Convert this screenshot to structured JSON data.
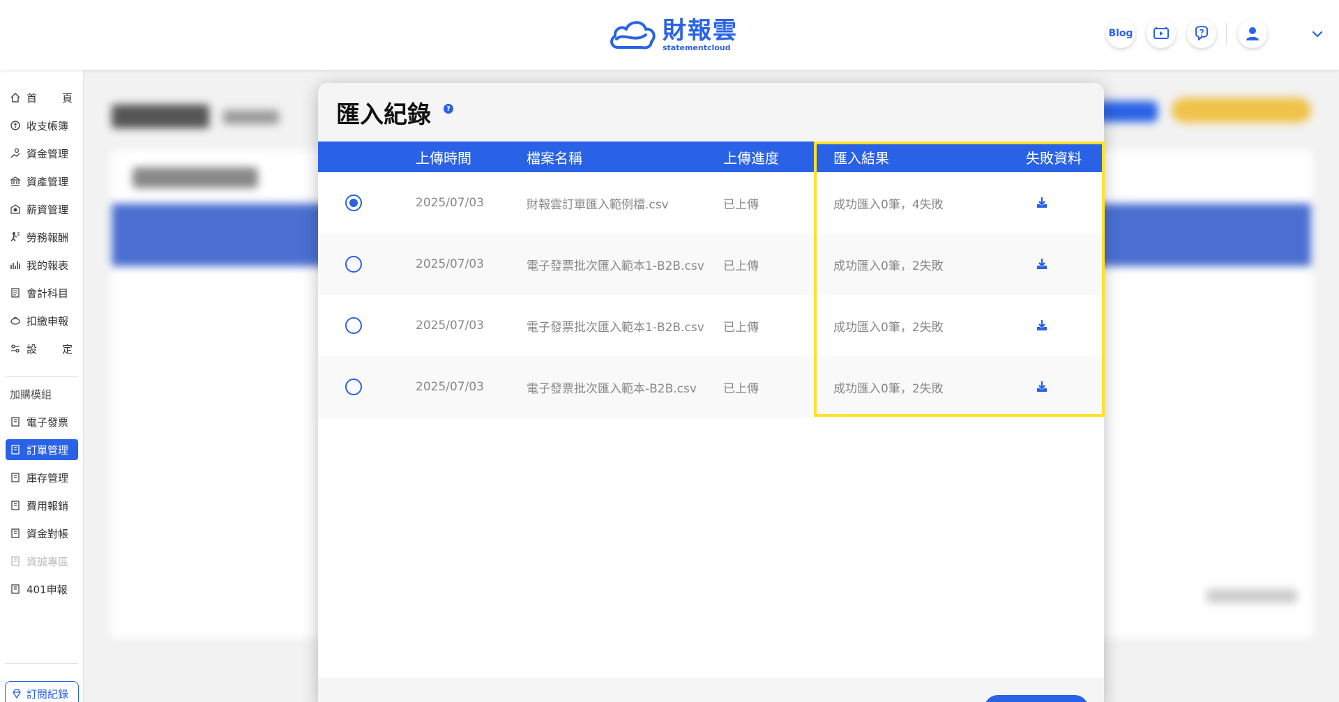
{
  "header": {
    "logo_cn": "財報雲",
    "logo_en": "statementcloud",
    "blog_label": "Blog"
  },
  "sidebar": {
    "items": [
      {
        "name": "home",
        "label": "首 頁",
        "icon": "home-icon"
      },
      {
        "name": "ledger",
        "label": "收支帳簿",
        "icon": "coin-icon"
      },
      {
        "name": "funds",
        "label": "資金管理",
        "icon": "hand-coin-icon"
      },
      {
        "name": "assets",
        "label": "資產管理",
        "icon": "bank-icon"
      },
      {
        "name": "payroll",
        "label": "薪資管理",
        "icon": "payroll-icon"
      },
      {
        "name": "labor",
        "label": "勞務報酬",
        "icon": "labor-icon"
      },
      {
        "name": "reports",
        "label": "我的報表",
        "icon": "chart-icon"
      },
      {
        "name": "accounts",
        "label": "會計科目",
        "icon": "book-icon"
      },
      {
        "name": "withholding",
        "label": "扣繳申報",
        "icon": "piggy-icon"
      },
      {
        "name": "settings",
        "label": "設 定",
        "icon": "sliders-icon"
      }
    ],
    "section_title": "加購模組",
    "modules": [
      {
        "name": "einvoice",
        "label": "電子發票"
      },
      {
        "name": "orders",
        "label": "訂單管理"
      },
      {
        "name": "inventory",
        "label": "庫存管理"
      },
      {
        "name": "expense",
        "label": "費用報銷"
      },
      {
        "name": "reconcile",
        "label": "資金對帳"
      },
      {
        "name": "security",
        "label": "資誠專區"
      },
      {
        "name": "vat401",
        "label": "401申報"
      }
    ],
    "subscription_label": "訂閱紀錄"
  },
  "modal": {
    "title": "匯入紀錄",
    "help_glyph": "?",
    "columns": [
      "上傳時間",
      "檔案名稱",
      "上傳進度",
      "匯入結果",
      "失敗資料"
    ],
    "rows": [
      {
        "selected": true,
        "time": "2025/07/03",
        "file": "財報雲訂單匯入範例檔.csv",
        "progress": "已上傳",
        "result": "成功匯入0筆，4失敗"
      },
      {
        "selected": false,
        "time": "2025/07/03",
        "file": "電子發票批次匯入範本1-B2B.csv",
        "progress": "已上傳",
        "result": "成功匯入0筆，2失敗"
      },
      {
        "selected": false,
        "time": "2025/07/03",
        "file": "電子發票批次匯入範本1-B2B.csv",
        "progress": "已上傳",
        "result": "成功匯入0筆，2失敗"
      },
      {
        "selected": false,
        "time": "2025/07/03",
        "file": "電子發票批次匯入範本-B2B.csv",
        "progress": "已上傳",
        "result": "成功匯入0筆，2失敗"
      }
    ]
  },
  "colors": {
    "accent": "#2962e6",
    "highlight": "#fde12d"
  }
}
